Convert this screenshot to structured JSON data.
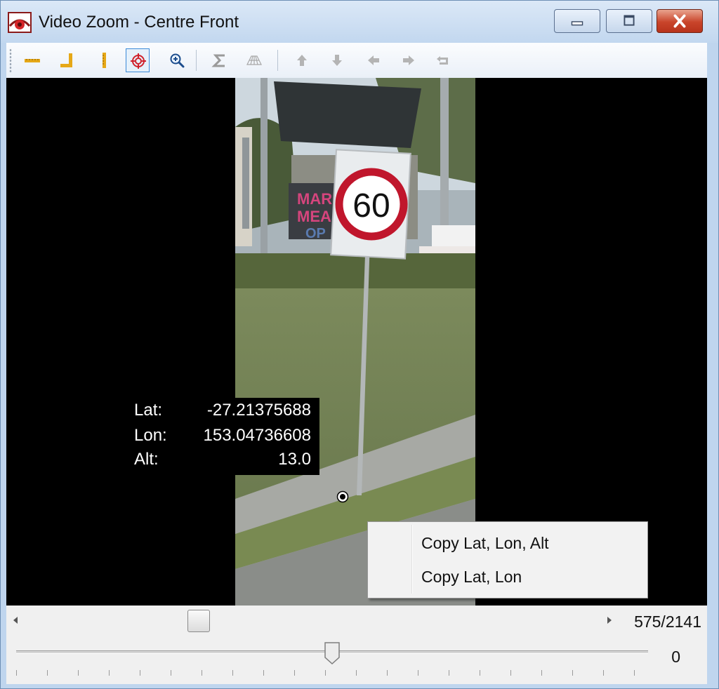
{
  "window": {
    "title": "Video Zoom - Centre Front",
    "controls": {
      "minimize": "minimize",
      "maximize": "maximize",
      "close": "close"
    }
  },
  "toolbar": {
    "items": [
      {
        "name": "horizontal-ruler",
        "state": "normal"
      },
      {
        "name": "corner-ruler",
        "state": "normal"
      },
      {
        "name": "vertical-ruler",
        "state": "normal"
      },
      {
        "name": "target-crosshair",
        "state": "active"
      },
      {
        "name": "zoom-in",
        "state": "normal"
      },
      {
        "name": "rotate-flip",
        "state": "disabled"
      },
      {
        "name": "perspective-grid",
        "state": "disabled"
      },
      {
        "name": "arrow-up",
        "state": "disabled"
      },
      {
        "name": "arrow-down",
        "state": "disabled"
      },
      {
        "name": "arrow-left",
        "state": "disabled"
      },
      {
        "name": "arrow-right",
        "state": "disabled"
      },
      {
        "name": "undo",
        "state": "disabled"
      }
    ]
  },
  "video": {
    "sign_text": "60",
    "coordinates": [
      {
        "label": "Lat:",
        "value": "-27.21375688"
      },
      {
        "label": "Lon:",
        "value": "153.04736608"
      },
      {
        "label": "Alt:",
        "value": "13.0"
      }
    ]
  },
  "context_menu": {
    "items": [
      {
        "label": "Copy Lat, Lon, Alt"
      },
      {
        "label": "Copy Lat, Lon"
      }
    ]
  },
  "scrollbar": {
    "position_fraction": 0.3
  },
  "frame": {
    "counter": "575/2141"
  },
  "slider": {
    "value": "0",
    "position_fraction": 0.5
  },
  "colors": {
    "title_bar": "#c8dbf1",
    "close_button": "#c9442a",
    "active_tool_border": "#3b8ad8",
    "sign_ring": "#c0162c"
  }
}
